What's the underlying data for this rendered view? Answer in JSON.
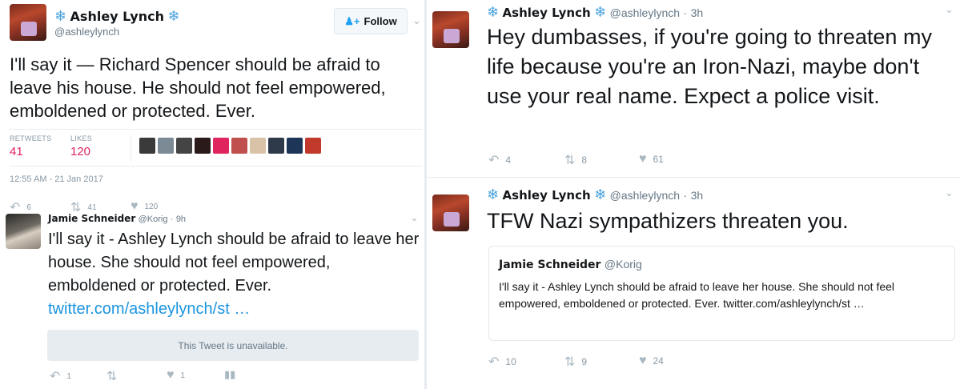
{
  "left_tweet": {
    "author_name": "Ashley Lynch",
    "author_handle": "@ashleylynch",
    "follow_label": "Follow",
    "text": "I'll say it — Richard Spencer should be afraid to leave his house.  He should not feel empowered, emboldened or protected.  Ever.",
    "retweets_label": "RETWEETS",
    "retweets_count": "41",
    "likes_label": "LIKES",
    "likes_count": "120",
    "timestamp": "12:55 AM - 21 Jan 2017",
    "actions": {
      "reply": "6",
      "retweet": "41",
      "like": "120"
    },
    "likers": [
      "#3a3a3a",
      "#7c8a96",
      "#444444",
      "#2a1a1a",
      "#e0245e",
      "#c0504d",
      "#d9c3a8",
      "#2e3a4a",
      "#1d3557",
      "#c0392b"
    ]
  },
  "reply_tweet": {
    "author_name": "Jamie Schneider",
    "author_handle": "@Korig",
    "time": "9h",
    "text": "I'll say it - Ashley Lynch should be afraid to leave her house. She should not feel empowered, emboldened or protected. Ever.",
    "link": "twitter.com/ashleylynch/st …",
    "unavailable_text": "This Tweet is unavailable.",
    "actions": {
      "reply": "1",
      "retweet": "",
      "like": "1"
    }
  },
  "right_tweet_1": {
    "author_name": "Ashley Lynch",
    "author_handle": "@ashleylynch",
    "time": "3h",
    "text": "Hey dumbasses, if you're going to threaten my life because you're an Iron-Nazi, maybe don't use your real name.  Expect a police visit.",
    "actions": {
      "reply": "4",
      "retweet": "8",
      "like": "61"
    }
  },
  "right_tweet_2": {
    "author_name": "Ashley Lynch",
    "author_handle": "@ashleylynch",
    "time": "3h",
    "text": "TFW Nazi sympathizers threaten you.",
    "quote": {
      "author_name": "Jamie Schneider",
      "author_handle": "@Korig",
      "text": "I'll say it - Ashley Lynch should be afraid to leave her house. She should not feel empowered, emboldened or protected. Ever. twitter.com/ashleylynch/st …"
    },
    "actions": {
      "reply": "10",
      "retweet": "9",
      "like": "24"
    }
  },
  "colors": {
    "accent": "#1da1f2",
    "like": "#e0245e",
    "muted": "#8899a6"
  }
}
